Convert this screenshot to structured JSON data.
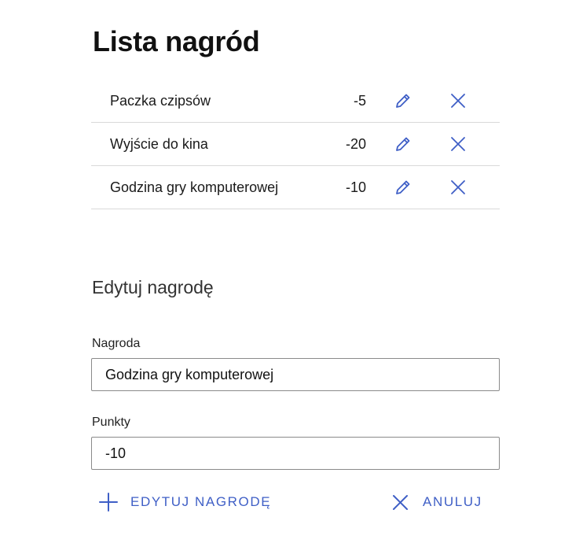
{
  "page": {
    "title": "Lista nagród"
  },
  "rewards": [
    {
      "name": "Paczka czipsów",
      "points": "-5"
    },
    {
      "name": "Wyjście do kina",
      "points": "-20"
    },
    {
      "name": "Godzina gry komputerowej",
      "points": "-10"
    }
  ],
  "icons": {
    "edit": "pencil-icon",
    "delete": "close-icon",
    "submit": "plus-icon",
    "cancel": "close-icon"
  },
  "form": {
    "title": "Edytuj nagrodę",
    "name_label": "Nagroda",
    "name_value": "Godzina gry komputerowej",
    "points_label": "Punkty",
    "points_value": "-10",
    "submit_label": "EDYTUJ NAGRODĘ",
    "cancel_label": "ANULUJ"
  },
  "colors": {
    "accent": "#3f5fc6",
    "divider": "#d9d9d9",
    "text": "#1a1a1a"
  }
}
